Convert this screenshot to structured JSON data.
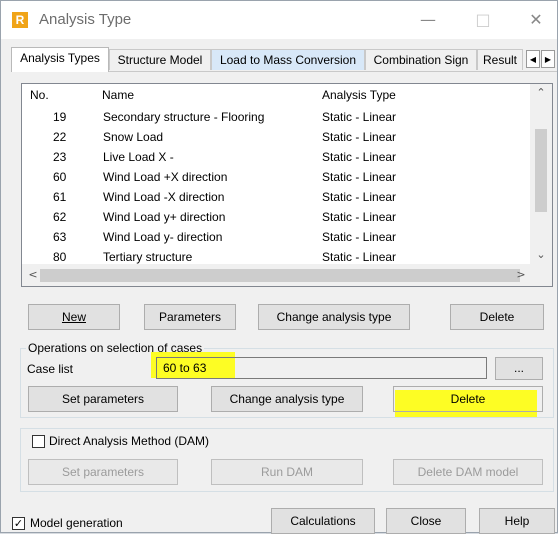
{
  "window": {
    "title": "Analysis Type",
    "app_icon_letter": "R",
    "minimize": "—",
    "maximize": "□",
    "close": "✕"
  },
  "tabs": [
    {
      "label": "Analysis Types"
    },
    {
      "label": "Structure Model"
    },
    {
      "label": "Load to Mass Conversion"
    },
    {
      "label": "Combination Sign"
    },
    {
      "label": "Result"
    }
  ],
  "tab_scroll": {
    "left": "◀",
    "right": "▶"
  },
  "table": {
    "columns": [
      "No.",
      "Name",
      "Analysis Type"
    ],
    "rows": [
      {
        "no": "19",
        "name": "Secondary structure - Flooring",
        "type": "Static - Linear"
      },
      {
        "no": "22",
        "name": "Snow Load",
        "type": "Static - Linear"
      },
      {
        "no": "23",
        "name": "Live Load X -",
        "type": "Static - Linear"
      },
      {
        "no": "60",
        "name": "Wind Load +X direction",
        "type": "Static - Linear"
      },
      {
        "no": "61",
        "name": "Wind Load -X direction",
        "type": "Static - Linear"
      },
      {
        "no": "62",
        "name": "Wind Load y+ direction",
        "type": "Static - Linear"
      },
      {
        "no": "63",
        "name": "Wind Load y- direction",
        "type": "Static - Linear"
      },
      {
        "no": "80",
        "name": "Tertiary structure",
        "type": "Static - Linear"
      }
    ],
    "scroll_up": "⌃",
    "scroll_down": "⌄",
    "scroll_left": "<",
    "scroll_right": ">"
  },
  "buttons": {
    "new": "New",
    "parameters": "Parameters",
    "change_type": "Change analysis type",
    "delete": "Delete"
  },
  "operations": {
    "group_label": "Operations on selection of cases",
    "case_list_label": "Case list",
    "case_list_value": "60 to 63",
    "browse": "...",
    "set_parameters": "Set parameters",
    "change_type": "Change analysis type",
    "delete": "Delete"
  },
  "dam": {
    "checkbox_label": "Direct Analysis Method (DAM)",
    "checked": false,
    "set_parameters": "Set parameters",
    "run": "Run DAM",
    "delete_model": "Delete DAM model"
  },
  "footer": {
    "model_generation_label": "Model generation",
    "model_generation_checked": true,
    "check_mark": "✓",
    "calculations": "Calculations",
    "close": "Close",
    "help": "Help"
  },
  "colors": {
    "highlight": "#ffff00",
    "tab_highlight": "#d8e8f8",
    "app_icon": "#f0a418"
  }
}
